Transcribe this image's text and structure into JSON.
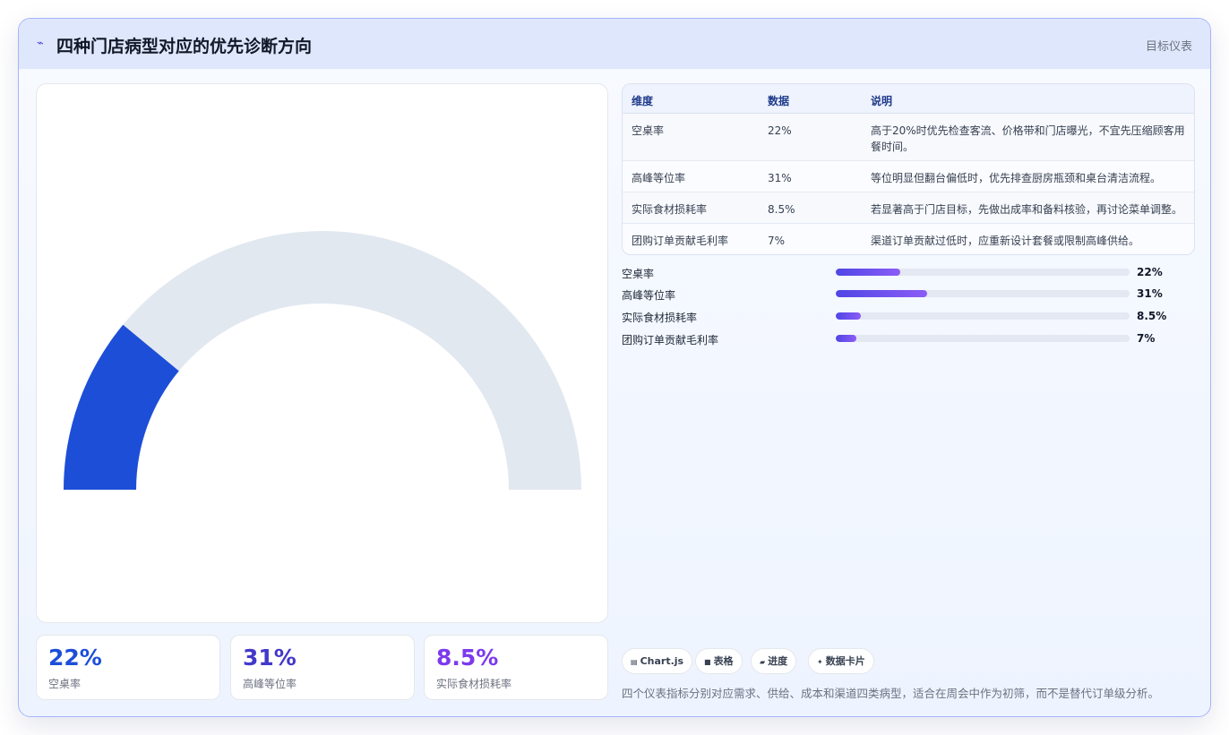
{
  "header": {
    "title": "四种门店病型对应的优先诊断方向",
    "tag": "目标仪表",
    "logo_icon": "chart-line-icon"
  },
  "gauge": {
    "value_percent": 22,
    "fill_color": "#1d4ed8",
    "track_color": "#e2e8f0"
  },
  "stats": [
    {
      "value": "22%",
      "label": "空桌率",
      "color": "#1d4ed8"
    },
    {
      "value": "31%",
      "label": "高峰等位率",
      "color": "#4338ca"
    },
    {
      "value": "8.5%",
      "label": "实际食材损耗率",
      "color": "#7c3aed"
    }
  ],
  "table": {
    "headers": [
      "维度",
      "数据",
      "说明"
    ],
    "rows": [
      {
        "dim": "空桌率",
        "value": "22%",
        "note": "高于20%时优先检查客流、价格带和门店曝光，不宜先压缩顾客用餐时间。"
      },
      {
        "dim": "高峰等位率",
        "value": "31%",
        "note": "等位明显但翻台偏低时，优先排查厨房瓶颈和桌台清洁流程。"
      },
      {
        "dim": "实际食材损耗率",
        "value": "8.5%",
        "note": "若显著高于门店目标，先做出成率和备料核验，再讨论菜单调整。"
      },
      {
        "dim": "团购订单贡献毛利率",
        "value": "7%",
        "note": "渠道订单贡献过低时，应重新设计套餐或限制高峰供给。"
      }
    ]
  },
  "progress": [
    {
      "label": "空桌率",
      "value": "22%",
      "fraction": 0.22
    },
    {
      "label": "高峰等位率",
      "value": "31%",
      "fraction": 0.31
    },
    {
      "label": "实际食材损耗率",
      "value": "8.5%",
      "fraction": 0.085
    },
    {
      "label": "团购订单贡献毛利率",
      "value": "7%",
      "fraction": 0.07
    }
  ],
  "chips": [
    {
      "label": "Chart.js",
      "icon": "chart-icon"
    },
    {
      "label": "表格",
      "icon": "table-icon"
    },
    {
      "label": "进度",
      "icon": "progress-icon"
    },
    {
      "label": "数据卡片",
      "icon": "sparkle-icon"
    }
  ],
  "footnote": "四个仪表指标分别对应需求、供给、成本和渠道四类病型，适合在周会中作为初筛，而不是替代订单级分析。"
}
